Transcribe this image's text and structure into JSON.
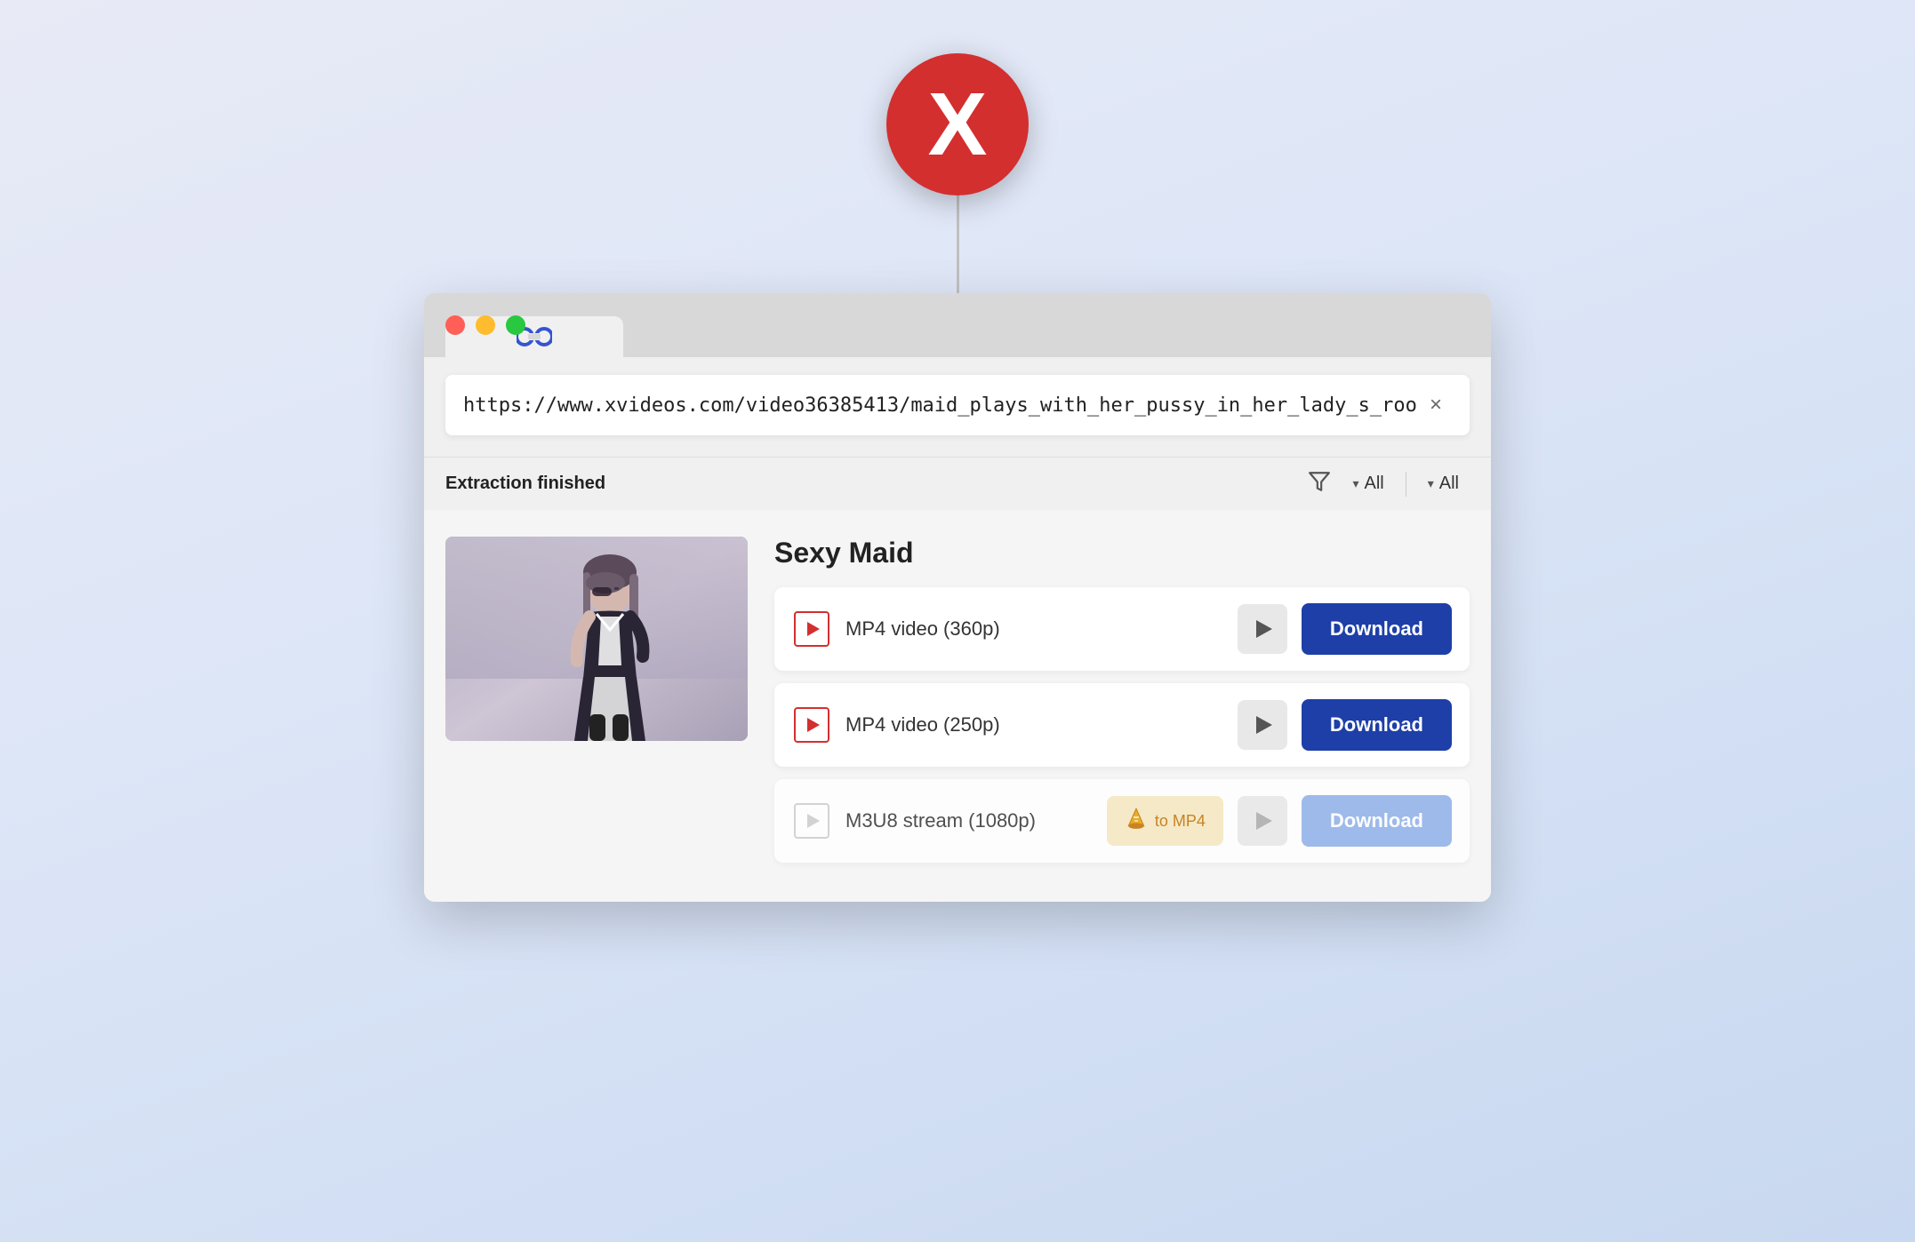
{
  "app": {
    "icon_letter": "X",
    "icon_color": "#d32f2f"
  },
  "window": {
    "controls": {
      "close_label": "close",
      "minimize_label": "minimize",
      "maximize_label": "maximize"
    },
    "tab": {
      "link_icon": "🔗"
    }
  },
  "address_bar": {
    "url": "https://www.xvideos.com/video36385413/maid_plays_with_her_pussy_in_her_lady_s_roo",
    "clear_label": "×"
  },
  "filter_bar": {
    "status": "Extraction finished",
    "filter_icon": "⧖",
    "dropdown1_label": "All",
    "dropdown2_label": "All"
  },
  "video": {
    "title": "Sexy Maid",
    "formats": [
      {
        "id": "format-360p",
        "icon_type": "video",
        "label": "MP4 video (360p)",
        "has_convert": false,
        "faded": false,
        "download_label": "Download"
      },
      {
        "id": "format-250p",
        "icon_type": "video",
        "label": "MP4 video (250p)",
        "has_convert": false,
        "faded": false,
        "download_label": "Download"
      },
      {
        "id": "format-1080p",
        "icon_type": "stream",
        "label": "M3U8 stream (1080p)",
        "has_convert": true,
        "convert_label": "to MP4",
        "faded": true,
        "download_label": "Download"
      }
    ]
  }
}
